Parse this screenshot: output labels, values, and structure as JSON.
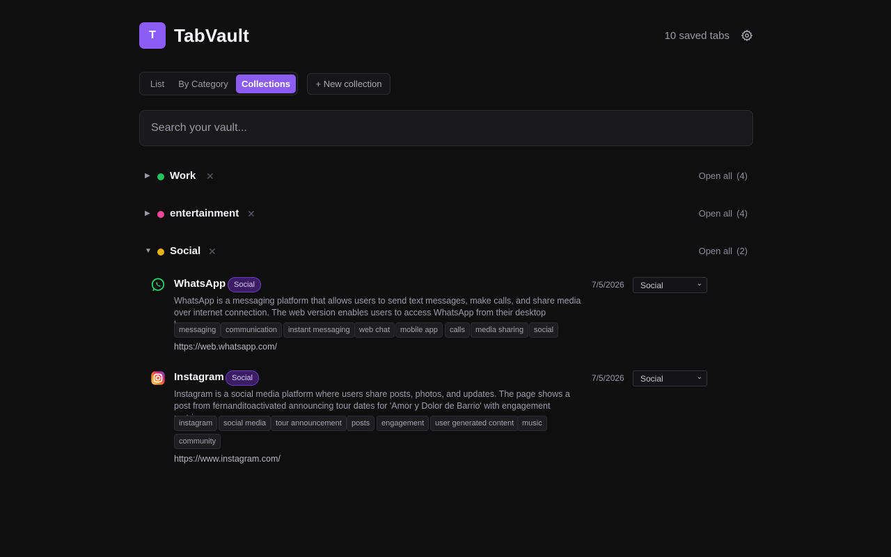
{
  "app": {
    "logo_letter": "T",
    "title": "TabVault",
    "saved_count": "10 saved tabs"
  },
  "view_tabs": [
    {
      "label": "List",
      "active": false
    },
    {
      "label": "By Category",
      "active": false
    },
    {
      "label": "Collections",
      "active": true
    }
  ],
  "new_collection_label": "+ New collection",
  "search": {
    "placeholder": "Search your vault...",
    "value": ""
  },
  "collections": [
    {
      "name": "Work",
      "color": "#22c55e",
      "expanded": false,
      "open_all": "Open all",
      "count": "(4)"
    },
    {
      "name": "entertainment",
      "color": "#ec4899",
      "expanded": false,
      "open_all": "Open all",
      "count": "(4)"
    },
    {
      "name": "Social",
      "color": "#eab308",
      "expanded": true,
      "open_all": "Open all",
      "count": "(2)"
    }
  ],
  "icons": {
    "expand": "caret-right-icon",
    "collapse": "caret-down-icon",
    "remove": "close-icon",
    "settings": "gear-icon"
  },
  "items": [
    {
      "title": "WhatsApp",
      "badge": "Social",
      "description": "WhatsApp is a messaging platform that allows users to send text messages, make calls, and share media over internet connection. The web version enables users to access WhatsApp from their desktop browser...",
      "tags": [
        "messaging",
        "communication",
        "instant messaging",
        "web chat",
        "mobile app",
        "calls",
        "media sharing",
        "social"
      ],
      "url": "https://web.whatsapp.com/",
      "date": "7/5/2026",
      "category": "Social",
      "icon": "whatsapp-icon"
    },
    {
      "title": "Instagram",
      "badge": "Social",
      "description": "Instagram is a social media platform where users share posts, photos, and updates. The page shows a post from fernanditoactivated announcing tour dates for 'Amor y Dolor de Barrio' with engagement metrics...",
      "tags": [
        "instagram",
        "social media",
        "tour announcement",
        "posts",
        "engagement",
        "user generated content",
        "music",
        "community"
      ],
      "url": "https://www.instagram.com/",
      "date": "7/5/2026",
      "category": "Social",
      "icon": "instagram-icon"
    }
  ]
}
